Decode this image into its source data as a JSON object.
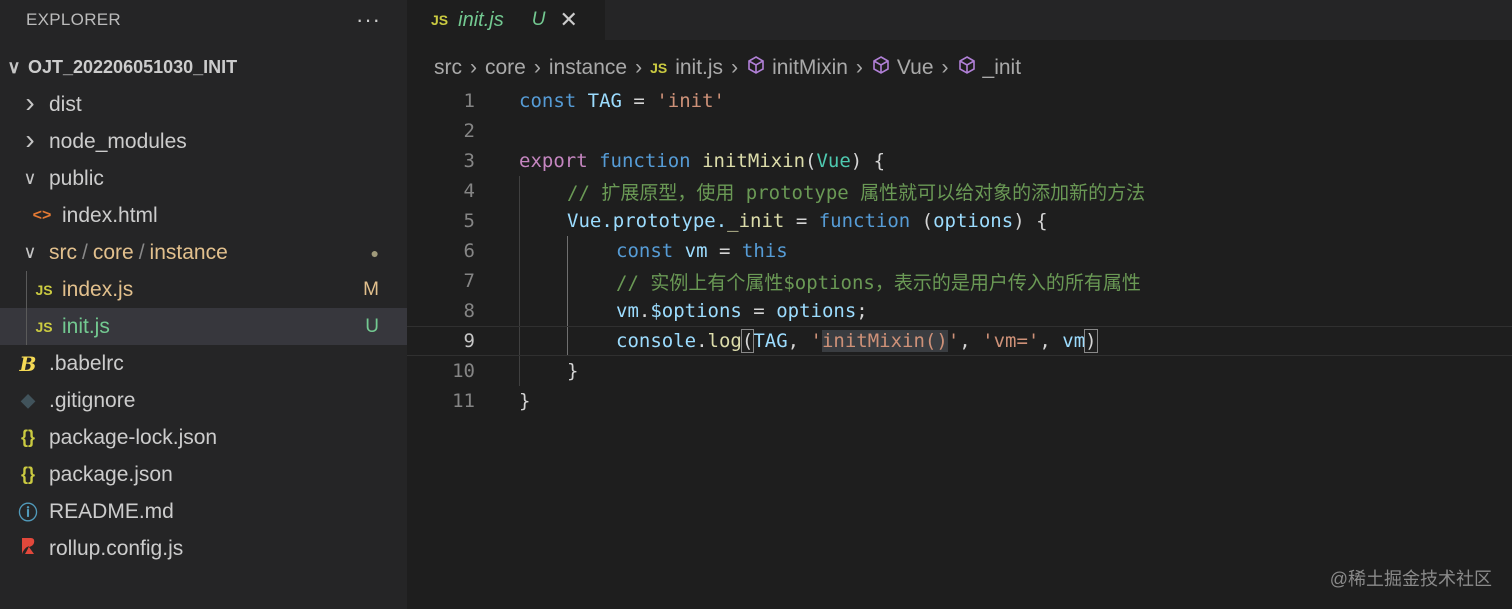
{
  "explorer": {
    "title": "EXPLORER",
    "more": "···",
    "root": "OJT_202206051030_INIT",
    "items": [
      {
        "label": "dist"
      },
      {
        "label": "node_modules"
      },
      {
        "label": "public"
      },
      {
        "label": "index.html"
      },
      {
        "label_parts": [
          "src",
          "core",
          "instance"
        ],
        "badge": "●"
      },
      {
        "label": "index.js",
        "badge": "M"
      },
      {
        "label": "init.js",
        "badge": "U"
      },
      {
        "label": ".babelrc"
      },
      {
        "label": ".gitignore"
      },
      {
        "label": "package-lock.json"
      },
      {
        "label": "package.json"
      },
      {
        "label": "README.md"
      },
      {
        "label": "rollup.config.js"
      }
    ]
  },
  "icons": {
    "js": "JS",
    "html": "<>",
    "json": "{}",
    "babel": "B",
    "info": "ⓘ"
  },
  "tab": {
    "name": "init.js",
    "status": "U",
    "close": "✕"
  },
  "breadcrumb": [
    "src",
    "core",
    "instance",
    "init.js",
    "initMixin",
    "Vue",
    "_init"
  ],
  "code": {
    "l1": {
      "a": "const",
      "b": "TAG",
      "c": " = ",
      "d": "'init'"
    },
    "l3": {
      "a": "export",
      "b": "function",
      "c": "initMixin",
      "d": "(",
      "e": "Vue",
      "f": ") {"
    },
    "l4": "// 扩展原型，使用 prototype 属性就可以给对象的添加新的方法",
    "l5": {
      "a": "Vue",
      "b": ".prototype.",
      "c": "_init",
      "d": " = ",
      "e": "function",
      "f": " (",
      "g": "options",
      "h": ") {"
    },
    "l6": {
      "a": "const",
      "b": "vm",
      "c": " = ",
      "d": "this"
    },
    "l7": "// 实例上有个属性$options，表示的是用户传入的所有属性",
    "l8": {
      "a": "vm",
      "b": ".",
      "c": "$options",
      "d": " = ",
      "e": "options",
      "f": ";"
    },
    "l9": {
      "a": "console",
      "b": ".",
      "c": "log",
      "d": "(",
      "e": "TAG",
      "f": ", ",
      "g": "'",
      "h": "initMixin()",
      "i": "'",
      "j": ", ",
      "k": "'vm='",
      "l": ", ",
      "m": "vm",
      "n": ")"
    },
    "l10": "}",
    "l11": "}"
  },
  "line_numbers": [
    "1",
    "2",
    "3",
    "4",
    "5",
    "6",
    "7",
    "8",
    "9",
    "10",
    "11"
  ],
  "watermark": "@稀土掘金技术社区"
}
